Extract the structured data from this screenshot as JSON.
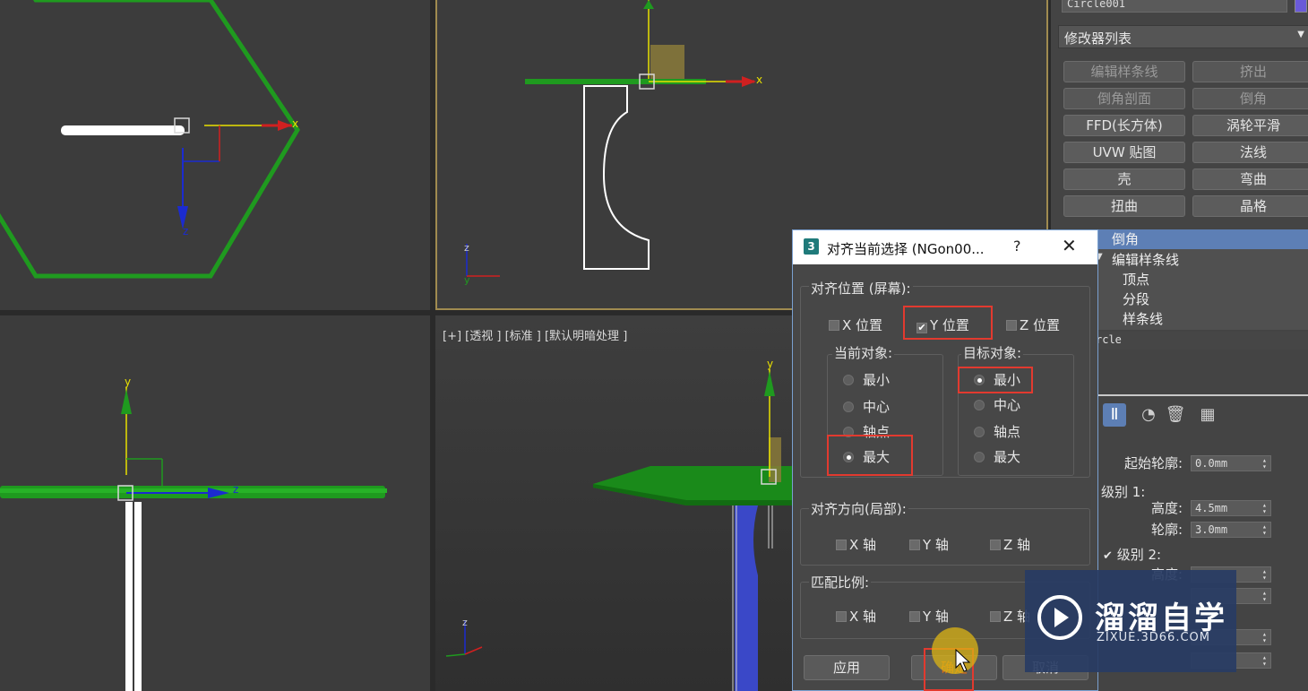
{
  "viewports": {
    "perspective_label": "[+] [透视 ] [标准 ] [默认明暗处理 ]",
    "top_axes": {
      "x": "x",
      "z": "z"
    },
    "front_axes": {
      "x": "x",
      "z": "z",
      "y": "y"
    },
    "left_axes": {
      "y": "y",
      "z": "z"
    },
    "persp_axes": {
      "y": "y",
      "z": "z"
    }
  },
  "command_panel": {
    "object_name": "Circle001",
    "modifier_list": "修改器列表",
    "modifier_buttons": [
      {
        "label": "编辑样条线",
        "enabled": false
      },
      {
        "label": "挤出",
        "enabled": false
      },
      {
        "label": "倒角剖面",
        "enabled": false
      },
      {
        "label": "倒角",
        "enabled": false
      },
      {
        "label": "FFD(长方体)",
        "enabled": true
      },
      {
        "label": "涡轮平滑",
        "enabled": true
      },
      {
        "label": "UVW 贴图",
        "enabled": true
      },
      {
        "label": "法线",
        "enabled": true
      },
      {
        "label": "壳",
        "enabled": true
      },
      {
        "label": "弯曲",
        "enabled": true
      },
      {
        "label": "扭曲",
        "enabled": true
      },
      {
        "label": "晶格",
        "enabled": true
      }
    ],
    "stack": {
      "item_bevel": "倒角",
      "item_edit_spline": "编辑样条线",
      "sub_vertex": "顶点",
      "sub_segment": "分段",
      "sub_spline": "样条线",
      "base": "rcle"
    },
    "params": {
      "start_outline_label": "起始轮廓:",
      "start_outline_value": "0.0mm",
      "level1_label": "级别 1:",
      "height_label": "高度:",
      "height_value": "4.5mm",
      "outline_label": "轮廓:",
      "outline_value": "3.0mm",
      "level2_label": "级别 2:",
      "level2_height_label": "高度:"
    }
  },
  "dialog": {
    "title": "对齐当前选择 (NGon00...",
    "help": "?",
    "close": "✕",
    "align_position_title": "对齐位置 (屏幕):",
    "x_pos": "X 位置",
    "y_pos": "Y 位置",
    "z_pos": "Z 位置",
    "y_checked": true,
    "current_object_title": "当前对象:",
    "target_object_title": "目标对象:",
    "current_options": [
      "最小",
      "中心",
      "轴点",
      "最大"
    ],
    "current_selected": "最大",
    "target_options": [
      "最小",
      "中心",
      "轴点",
      "最大"
    ],
    "target_selected": "最小",
    "orientation_title": "对齐方向(局部):",
    "orient_x": "X 轴",
    "orient_y": "Y 轴",
    "orient_z": "Z 轴",
    "scale_title": "匹配比例:",
    "scale_x": "X 轴",
    "scale_y": "Y 轴",
    "scale_z": "Z 轴",
    "apply_button": "应用",
    "ok_button": "确定",
    "cancel_button": "取消"
  },
  "watermark": {
    "brand": "溜溜自学",
    "url": "ZIXUE.3D66.COM"
  },
  "colors": {
    "accent_selection": "#5d7fb5",
    "highlight_box": "#e23a2f",
    "gizmo_green": "#1f9a1f",
    "axis_red": "#d02020",
    "axis_blue": "#1b2bd0",
    "axis_yellow": "#e8e000"
  }
}
